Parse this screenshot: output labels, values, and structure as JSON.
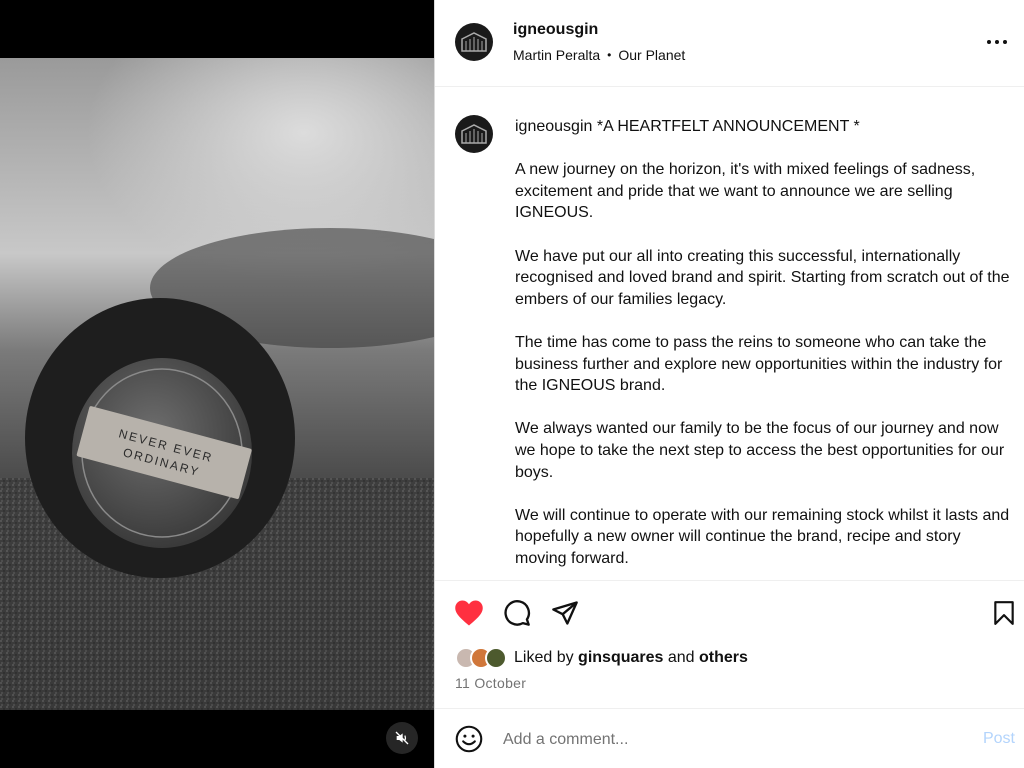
{
  "post": {
    "username": "igneousgin",
    "audio_artist": "Martin Peralta",
    "audio_separator": "•",
    "audio_track": "Our Planet",
    "caption_username": "igneousgin",
    "caption_title": "*A HEARTFELT ANNOUNCEMENT *",
    "paragraphs": [
      "A new journey on the horizon, it's with mixed feelings of sadness, excitement and pride that we want to announce we are selling IGNEOUS.",
      "We have put our all into creating this successful, internationally recognised and loved brand and spirit. Starting from scratch out of the embers of our families legacy.",
      "The time has come to pass the reins to someone who can take the business further and explore new opportunities within the industry for the IGNEOUS brand.",
      "We always wanted our family to be the focus of our journey and now we hope to take the next step to access the best opportunities for our boys.",
      "We will continue to operate with our remaining stock whilst it lasts and hopefully a new owner will continue the brand, recipe and story moving forward."
    ],
    "media_label_line1": "NEVER EVER",
    "media_label_line2": "ORDINARY"
  },
  "likes": {
    "prefix": "Liked by",
    "user": "ginsquares",
    "middle": "and",
    "others": "others",
    "liked": true
  },
  "date": "11 October",
  "comment": {
    "placeholder": "Add a comment...",
    "post_label": "Post"
  },
  "icons": {
    "heart": "heart-filled-icon",
    "comment": "comment-icon",
    "share": "send-icon",
    "save": "bookmark-icon",
    "more": "more-horizontal-icon",
    "mute": "speaker-muted-icon",
    "emoji": "emoji-icon"
  },
  "colors": {
    "like_red": "#ff3040",
    "post_button_disabled": "#b3d4fc",
    "muted_text": "#737373"
  }
}
